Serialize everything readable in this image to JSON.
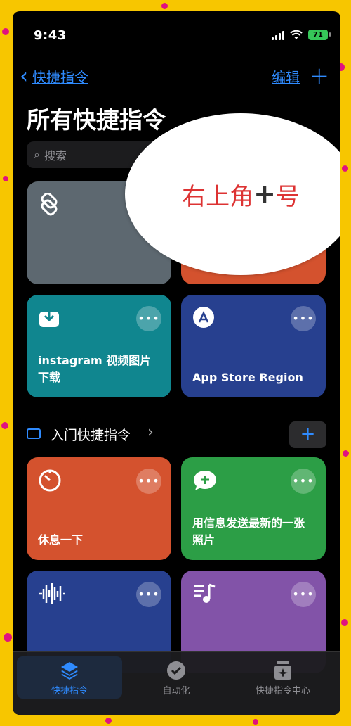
{
  "status": {
    "time": "9:43",
    "battery": "71"
  },
  "nav": {
    "back_label": "快捷指令",
    "edit_label": "编辑",
    "add_glyph": "+"
  },
  "page_title": "所有快捷指令",
  "search": {
    "placeholder": "搜索"
  },
  "cards": [
    {
      "label": "",
      "color": "#5d6870"
    },
    {
      "label": "",
      "color": "#d4522e"
    },
    {
      "label": "instagram 视频图片下载",
      "color": "#10868f"
    },
    {
      "label": "App Store Region",
      "color": "#27408f"
    }
  ],
  "callout": {
    "text_before": "右上角",
    "text_symbol": "+",
    "text_after": "号"
  },
  "folder": {
    "label": "入门快捷指令",
    "chevron": "›",
    "add_glyph": "+"
  },
  "starter_cards": [
    {
      "label": "休息一下",
      "color": "#d4522e"
    },
    {
      "label": "用信息发送最新的一张照片",
      "color": "#2c9e46"
    },
    {
      "label": "",
      "color": "#27408f"
    },
    {
      "label": "",
      "color": "#8253a8"
    }
  ],
  "more_glyph": "•••",
  "tabbar": {
    "tabs": [
      {
        "label": "快捷指令",
        "active": true
      },
      {
        "label": "自动化",
        "active": false
      },
      {
        "label": "快捷指令中心",
        "active": false
      }
    ]
  }
}
